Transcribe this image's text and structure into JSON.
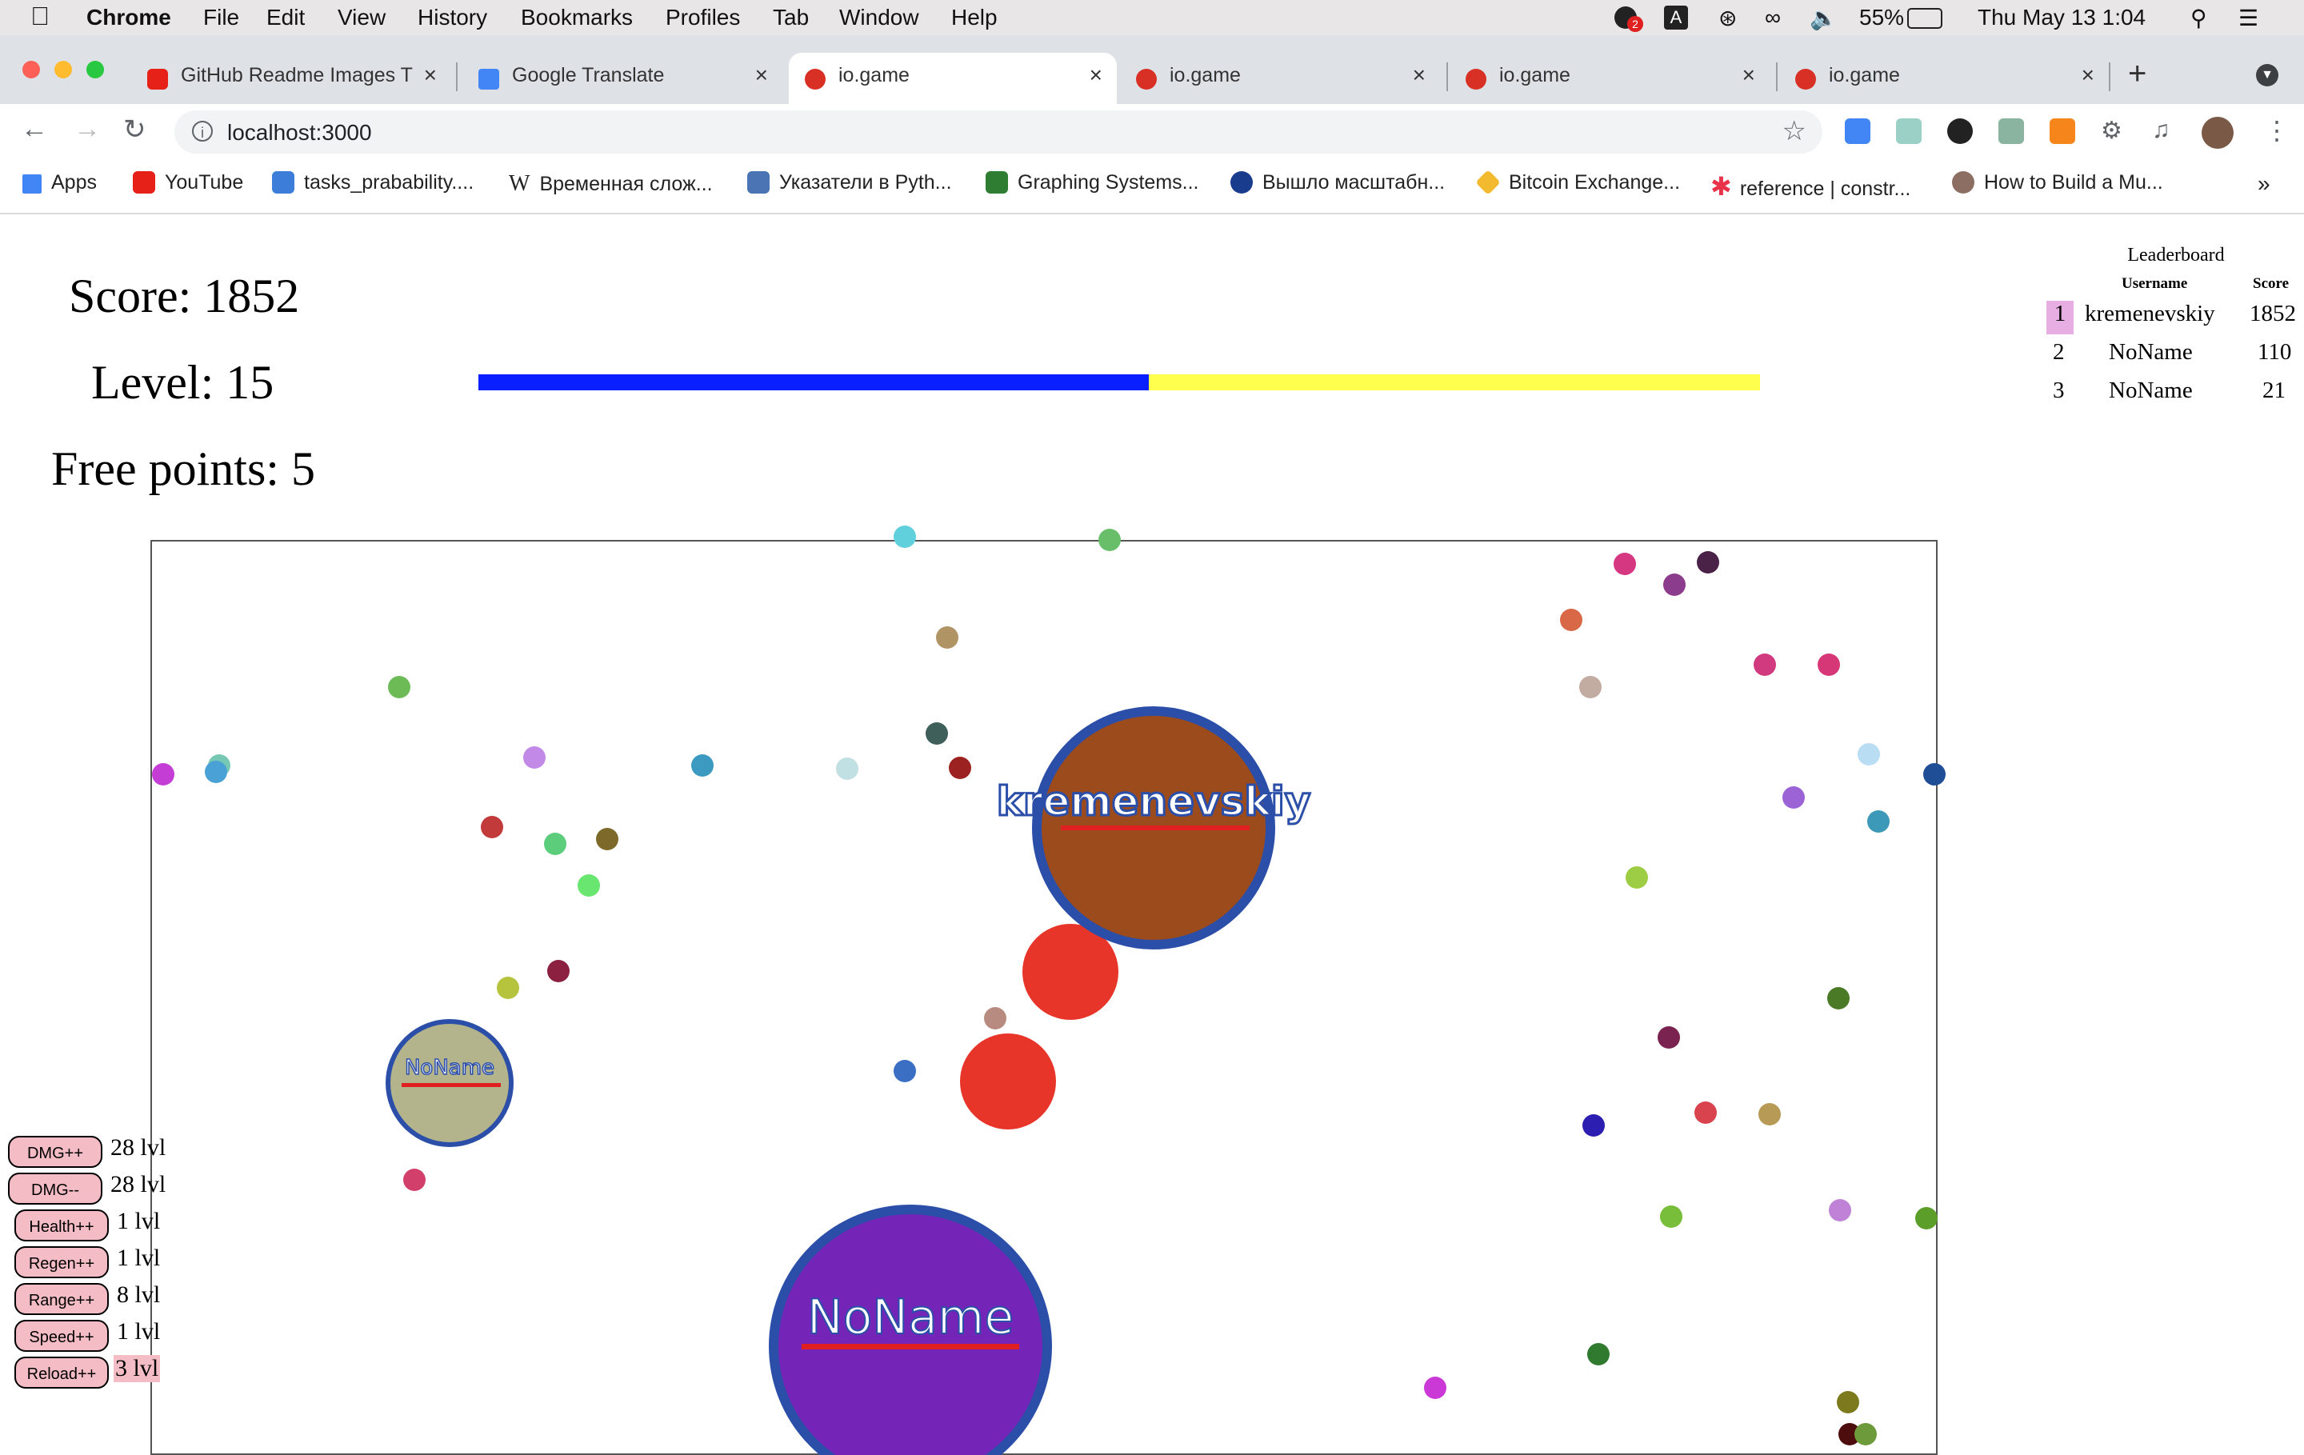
{
  "menubar": {
    "app": "Chrome",
    "items": [
      "File",
      "Edit",
      "View",
      "History",
      "Bookmarks",
      "Profiles",
      "Tab",
      "Window",
      "Help"
    ],
    "battery": "55%",
    "clock": "Thu May 13  1:04",
    "notification_count": "2"
  },
  "tabs": [
    {
      "title": "GitHub Readme Images T",
      "icon": "youtube-icon",
      "active": false
    },
    {
      "title": "Google Translate",
      "icon": "google-translate-icon",
      "active": false
    },
    {
      "title": "io.game",
      "icon": "game-icon",
      "active": true
    },
    {
      "title": "io.game",
      "icon": "game-icon",
      "active": false
    },
    {
      "title": "io.game",
      "icon": "game-icon",
      "active": false
    },
    {
      "title": "io.game",
      "icon": "game-icon",
      "active": false
    }
  ],
  "address": {
    "url": "localhost:3000"
  },
  "bookmarks": [
    {
      "label": "Apps"
    },
    {
      "label": "YouTube"
    },
    {
      "label": "tasks_prabability...."
    },
    {
      "label": "Временная слож..."
    },
    {
      "label": "Указатели в Pyth..."
    },
    {
      "label": "Graphing Systems..."
    },
    {
      "label": "Вышло масштабн..."
    },
    {
      "label": "Bitcoin Exchange..."
    },
    {
      "label": "reference | constr..."
    },
    {
      "label": "How to Build a Mu..."
    }
  ],
  "hud": {
    "score": "Score: 1852",
    "level": "Level: 15",
    "free_points": "Free points: 5",
    "level_progress": 0.523
  },
  "leaderboard": {
    "title": "Leaderboard",
    "col_user": "Username",
    "col_score": "Score",
    "rows": [
      {
        "rank": "1",
        "username": "kremenevskiy",
        "score": "1852"
      },
      {
        "rank": "2",
        "username": "NoName",
        "score": "110"
      },
      {
        "rank": "3",
        "username": "NoName",
        "score": "21"
      }
    ]
  },
  "players": [
    {
      "name": "kremenevskiy",
      "fill": "#9c4b1c",
      "ring": "#2b4ea8"
    },
    {
      "name": "NoName",
      "fill": "#b4b48c",
      "ring": "#2b4ea8"
    },
    {
      "name": "NoName",
      "fill": "#7425b8",
      "ring": "#2b4ea8"
    }
  ],
  "upgrades": [
    {
      "label": "DMG++",
      "level": "28 lvl"
    },
    {
      "label": "DMG--",
      "level": "28 lvl"
    },
    {
      "label": "Health++",
      "level": "1 lvl"
    },
    {
      "label": "Regen++",
      "level": "1 lvl"
    },
    {
      "label": "Range++",
      "level": "8 lvl"
    },
    {
      "label": "Speed++",
      "level": "1 lvl"
    },
    {
      "label": "Reload++",
      "level": "3 lvl"
    }
  ],
  "colors": {
    "accent_red": "#d93025",
    "bullet": "#e8352a",
    "upgrade_bg": "#f4bcc4"
  }
}
